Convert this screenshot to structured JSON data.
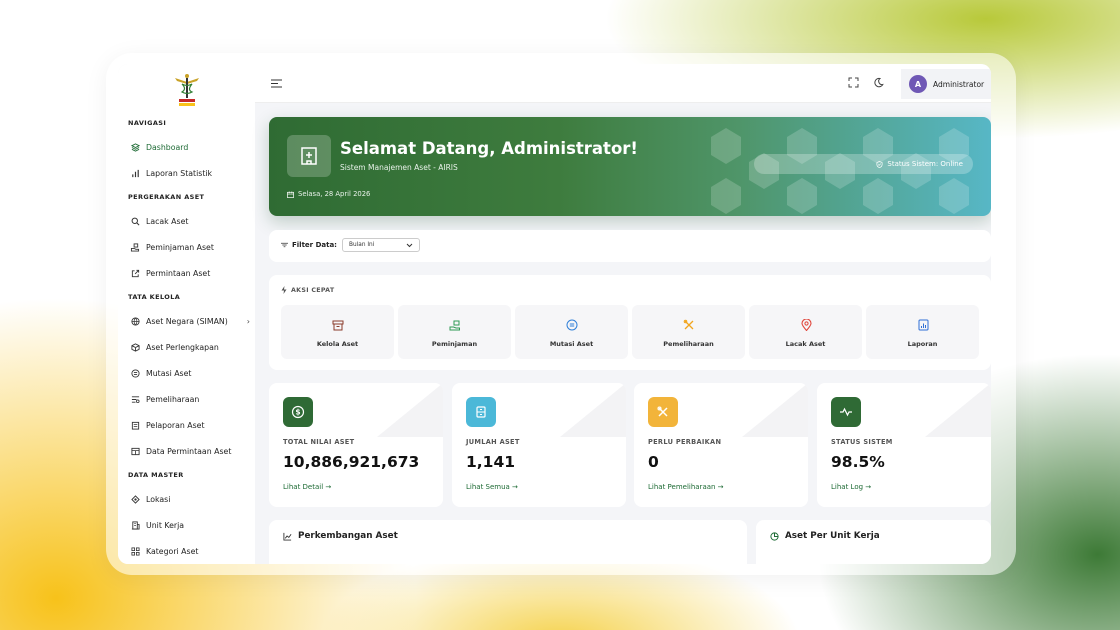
{
  "sidebar": {
    "sections": [
      {
        "title": "NAVIGASI",
        "items": [
          {
            "label": "Dashboard",
            "icon": "layers-icon",
            "active": true
          },
          {
            "label": "Laporan Statistik",
            "icon": "bar-chart-icon"
          }
        ]
      },
      {
        "title": "PERGERAKAN ASET",
        "items": [
          {
            "label": "Lacak Aset",
            "icon": "search-icon"
          },
          {
            "label": "Peminjaman Aset",
            "icon": "hand-box-icon"
          },
          {
            "label": "Permintaan Aset",
            "icon": "external-link-icon"
          }
        ]
      },
      {
        "title": "TATA KELOLA",
        "items": [
          {
            "label": "Aset Negara (SIMAN)",
            "icon": "globe-icon",
            "has_chevron": true
          },
          {
            "label": "Aset Perlengkapan",
            "icon": "cube-icon"
          },
          {
            "label": "Mutasi Aset",
            "icon": "circle-equals-icon"
          },
          {
            "label": "Pemeliharaan",
            "icon": "tools-list-icon"
          },
          {
            "label": "Pelaporan Aset",
            "icon": "clipboard-icon"
          },
          {
            "label": "Data Permintaan Aset",
            "icon": "table-icon"
          }
        ]
      },
      {
        "title": "DATA MASTER",
        "items": [
          {
            "label": "Lokasi",
            "icon": "location-diamond-icon"
          },
          {
            "label": "Unit Kerja",
            "icon": "building-icon"
          },
          {
            "label": "Kategori Aset",
            "icon": "grid-icon"
          }
        ]
      }
    ]
  },
  "topbar": {
    "user_initial": "A",
    "user_name": "Administrator"
  },
  "banner": {
    "title": "Selamat Datang, Administrator!",
    "subtitle": "Sistem Manajemen Aset - AIRIS",
    "date": "Selasa, 28 April 2026",
    "status": "Status Sistem: Online"
  },
  "filter": {
    "label": "Filter Data:",
    "selected": "Bulan Ini"
  },
  "quick_actions": {
    "title": "AKSI CEPAT",
    "items": [
      {
        "label": "Kelola Aset",
        "icon": "archive-box-icon",
        "color": "#8a3b2a"
      },
      {
        "label": "Peminjaman",
        "icon": "hand-box-icon",
        "color": "#2e9a55"
      },
      {
        "label": "Mutasi Aset",
        "icon": "circle-equals-icon",
        "color": "#2f7fd8"
      },
      {
        "label": "Pemeliharaan",
        "icon": "tools-icon",
        "color": "#f2a51d"
      },
      {
        "label": "Lacak Aset",
        "icon": "map-pin-icon",
        "color": "#e0443a"
      },
      {
        "label": "Laporan",
        "icon": "report-chart-icon",
        "color": "#2f6fd6"
      }
    ]
  },
  "stats": [
    {
      "label": "TOTAL NILAI ASET",
      "value": "10,886,921,673",
      "link": "Lihat Detail →",
      "icon": "dollar-circle-icon",
      "color": "#2f6a35"
    },
    {
      "label": "JUMLAH ASET",
      "value": "1,141",
      "link": "Lihat Semua →",
      "icon": "cabinet-icon",
      "color": "#4bb8d8"
    },
    {
      "label": "PERLU PERBAIKAN",
      "value": "0",
      "link": "Lihat Pemeliharaan →",
      "icon": "tools-icon",
      "color": "#f2b43a"
    },
    {
      "label": "STATUS SISTEM",
      "value": "98.5%",
      "link": "Lihat Log →",
      "icon": "activity-icon",
      "color": "#2f6a35"
    }
  ],
  "charts": {
    "growth_title": "Perkembangan Aset",
    "unit_title": "Aset Per Unit Kerja"
  }
}
